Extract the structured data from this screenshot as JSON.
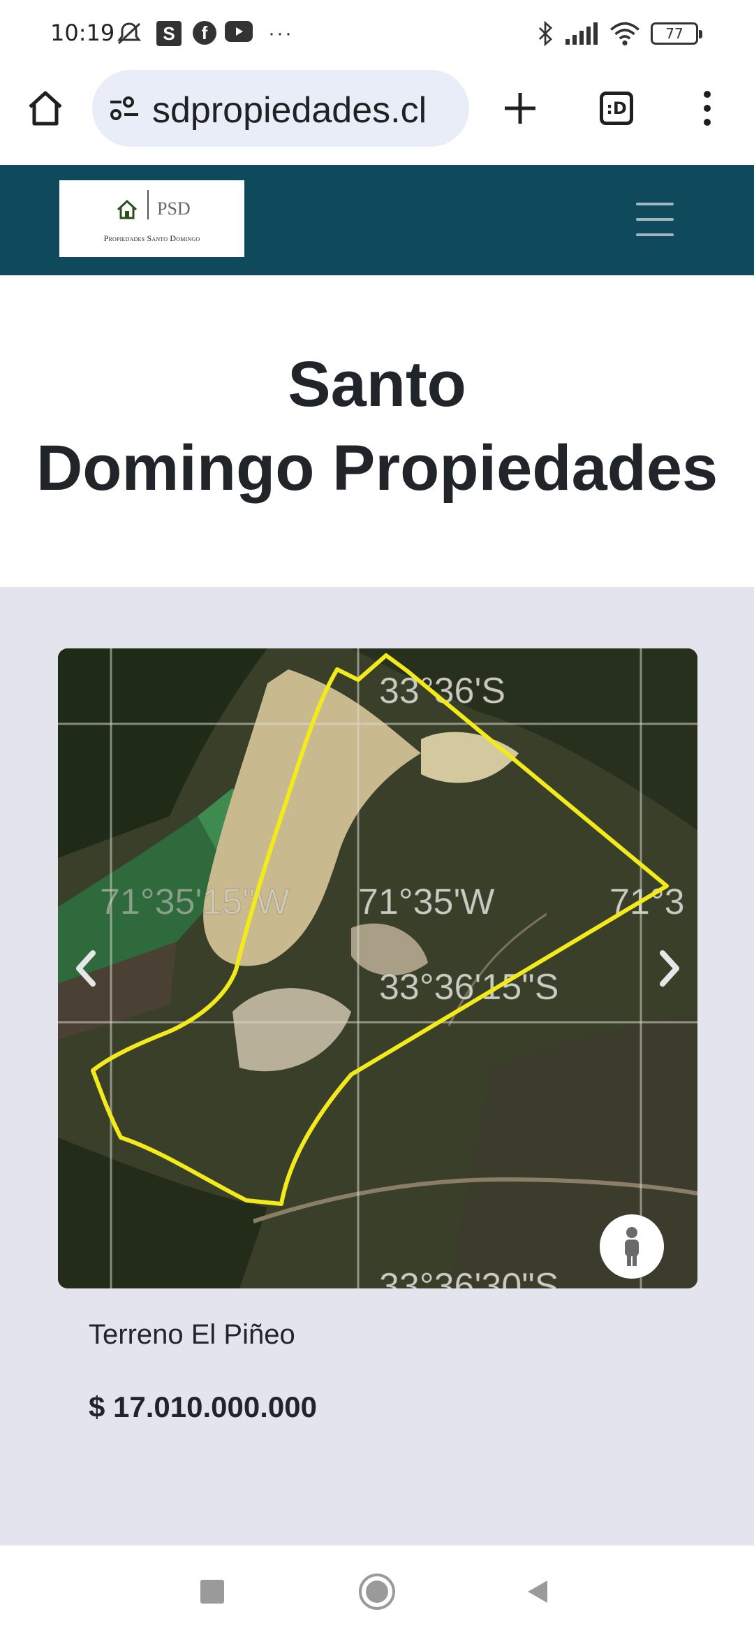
{
  "status_bar": {
    "time": "10:19",
    "s_icon": "S",
    "fb_icon": "f",
    "more": "···",
    "battery": "77",
    "icons": [
      "mute-icon",
      "s-app-icon",
      "facebook-icon",
      "youtube-icon",
      "bluetooth-icon",
      "signal-icon",
      "wifi-icon",
      "battery-icon"
    ]
  },
  "browser": {
    "url": "sdpropiedades.cl",
    "tabs_label": ":D",
    "icons": [
      "home-icon",
      "site-settings-icon",
      "new-tab-icon",
      "tabs-icon",
      "menu-icon"
    ]
  },
  "navbar": {
    "logo_text": "PSD",
    "logo_subtitle": "Propiedades Santo Domingo",
    "background": "#0f4a5c"
  },
  "hero": {
    "title_line1": "Santo",
    "title_line2": "Domingo Propiedades"
  },
  "listing": {
    "image_labels": [
      "33°36'S",
      "71°35'W",
      "33°36'15\"S",
      "71°35'15\"W",
      "71°3",
      "33°36'30\"S"
    ],
    "title": "Terreno El Piñeo",
    "price": "$ 17.010.000.000",
    "boundary_color": "#f3ea1c"
  },
  "bottom_nav": {
    "icons": [
      "recents-icon",
      "home-circle-icon",
      "back-icon"
    ]
  }
}
